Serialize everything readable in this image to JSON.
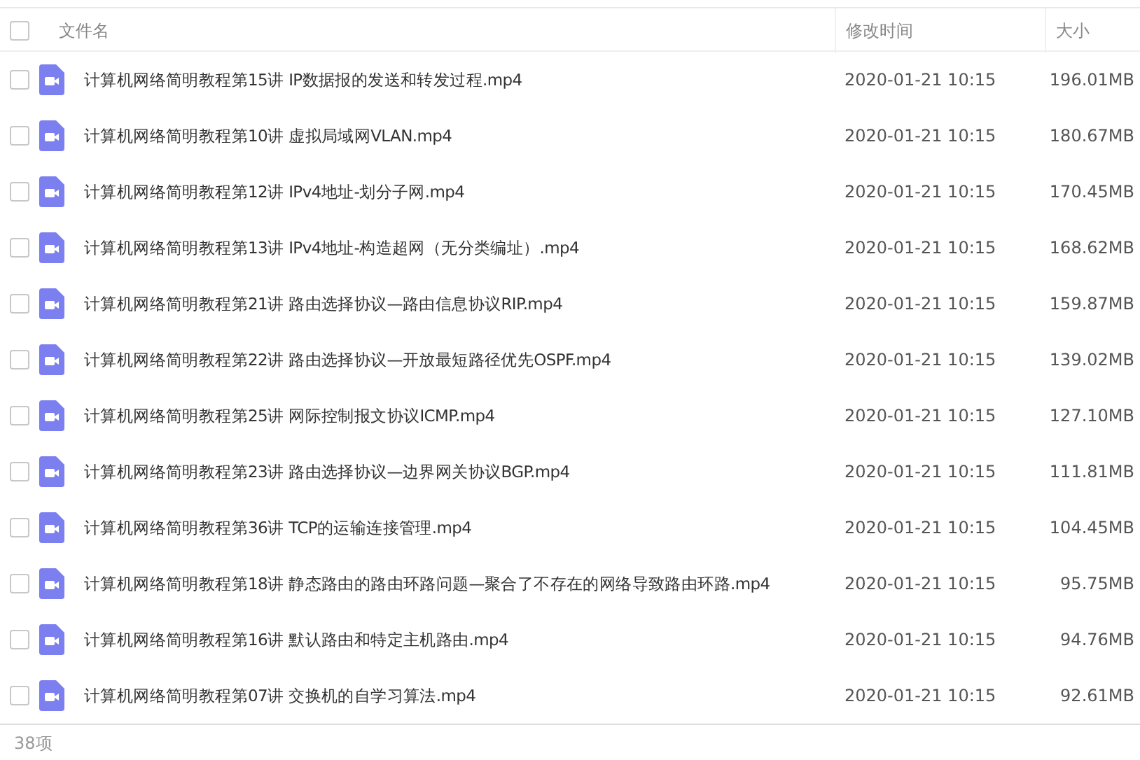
{
  "table": {
    "header_checked": false,
    "columns": [
      "文件名",
      "修改时间",
      "大小"
    ],
    "rows": [
      {
        "name": "计算机网络简明教程第15讲 IP数据报的发送和转发过程.mp4",
        "modified": "2020-01-21 10:15",
        "size": "196.01MB",
        "checked": false
      },
      {
        "name": "计算机网络简明教程第10讲 虚拟局域网VLAN.mp4",
        "modified": "2020-01-21 10:15",
        "size": "180.67MB",
        "checked": false
      },
      {
        "name": "计算机网络简明教程第12讲 IPv4地址-划分子网.mp4",
        "modified": "2020-01-21 10:15",
        "size": "170.45MB",
        "checked": false
      },
      {
        "name": "计算机网络简明教程第13讲 IPv4地址-构造超网（无分类编址）.mp4",
        "modified": "2020-01-21 10:15",
        "size": "168.62MB",
        "checked": false
      },
      {
        "name": "计算机网络简明教程第21讲 路由选择协议—路由信息协议RIP.mp4",
        "modified": "2020-01-21 10:15",
        "size": "159.87MB",
        "checked": false
      },
      {
        "name": "计算机网络简明教程第22讲 路由选择协议—开放最短路径优先OSPF.mp4",
        "modified": "2020-01-21 10:15",
        "size": "139.02MB",
        "checked": false
      },
      {
        "name": "计算机网络简明教程第25讲 网际控制报文协议ICMP.mp4",
        "modified": "2020-01-21 10:15",
        "size": "127.10MB",
        "checked": false
      },
      {
        "name": "计算机网络简明教程第23讲 路由选择协议—边界网关协议BGP.mp4",
        "modified": "2020-01-21 10:15",
        "size": "111.81MB",
        "checked": false
      },
      {
        "name": "计算机网络简明教程第36讲 TCP的运输连接管理.mp4",
        "modified": "2020-01-21 10:15",
        "size": "104.45MB",
        "checked": false
      },
      {
        "name": "计算机网络简明教程第18讲 静态路由的路由环路问题—聚合了不存在的网络导致路由环路.mp4",
        "modified": "2020-01-21 10:15",
        "size": "95.75MB",
        "checked": false
      },
      {
        "name": "计算机网络简明教程第16讲 默认路由和特定主机路由.mp4",
        "modified": "2020-01-21 10:15",
        "size": "94.76MB",
        "checked": false
      },
      {
        "name": "计算机网络简明教程第07讲 交换机的自学习算法.mp4",
        "modified": "2020-01-21 10:15",
        "size": "92.61MB",
        "checked": false
      }
    ]
  },
  "status_bar": {
    "count": "38项"
  }
}
